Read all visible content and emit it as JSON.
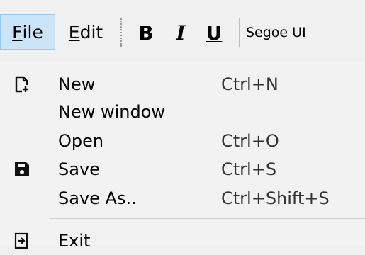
{
  "menubar": {
    "file_label_first": "F",
    "file_label_rest": "ile",
    "edit_label_first": "E",
    "edit_label_rest": "dit",
    "bold": "B",
    "italic": "I",
    "underline": "U",
    "font_name": "Segoe UI"
  },
  "file_menu": {
    "items": [
      {
        "label": "New",
        "shortcut": "Ctrl+N",
        "icon": "new-file-icon"
      },
      {
        "label": "New window",
        "shortcut": "",
        "icon": ""
      },
      {
        "label": "Open",
        "shortcut": "Ctrl+O",
        "icon": ""
      },
      {
        "label": "Save",
        "shortcut": "Ctrl+S",
        "icon": "floppy-disk-icon"
      },
      {
        "label": "Save As..",
        "shortcut": "Ctrl+Shift+S",
        "icon": ""
      },
      {
        "label": "Exit",
        "shortcut": "",
        "icon": "exit-icon"
      }
    ]
  },
  "colors": {
    "menubar_bg": "#f0f0f0",
    "file_highlight": "#cce4f7",
    "file_highlight_border": "#99c9ef",
    "dropdown_bg": "#f2f2f2"
  }
}
